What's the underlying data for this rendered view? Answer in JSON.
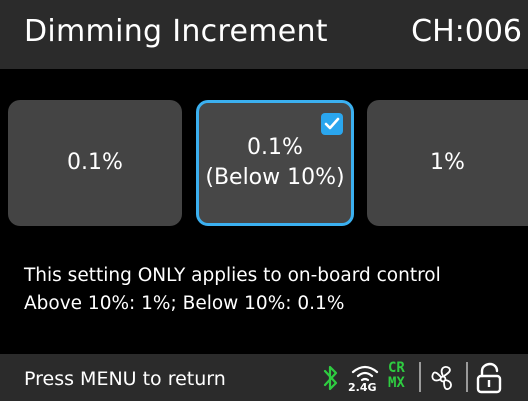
{
  "header": {
    "title": "Dimming Increment",
    "channel": "CH:006"
  },
  "options": [
    {
      "label_line1": "0.1%",
      "label_line2": "",
      "selected": false
    },
    {
      "label_line1": "0.1%",
      "label_line2": "(Below 10%)",
      "selected": true
    },
    {
      "label_line1": "1%",
      "label_line2": "",
      "selected": false
    }
  ],
  "info": {
    "line1": "This setting ONLY applies to on-board control",
    "line2": "Above 10%: 1%; Below 10%: 0.1%"
  },
  "footer": {
    "hint": "Press MENU to return",
    "wifi_label": "2.4G",
    "crmx_top": "CR",
    "crmx_bottom": "MX",
    "status_icons": [
      "bluetooth-icon",
      "wireless-2-4g-icon",
      "crmx-icon",
      "fan-icon",
      "unlock-icon"
    ]
  },
  "colors": {
    "accent": "#2aa6ee",
    "bluetooth": "#2ecc40",
    "crmx": "#2ecc40",
    "bar_background": "#2b2b2b",
    "tile_background": "#444444"
  }
}
